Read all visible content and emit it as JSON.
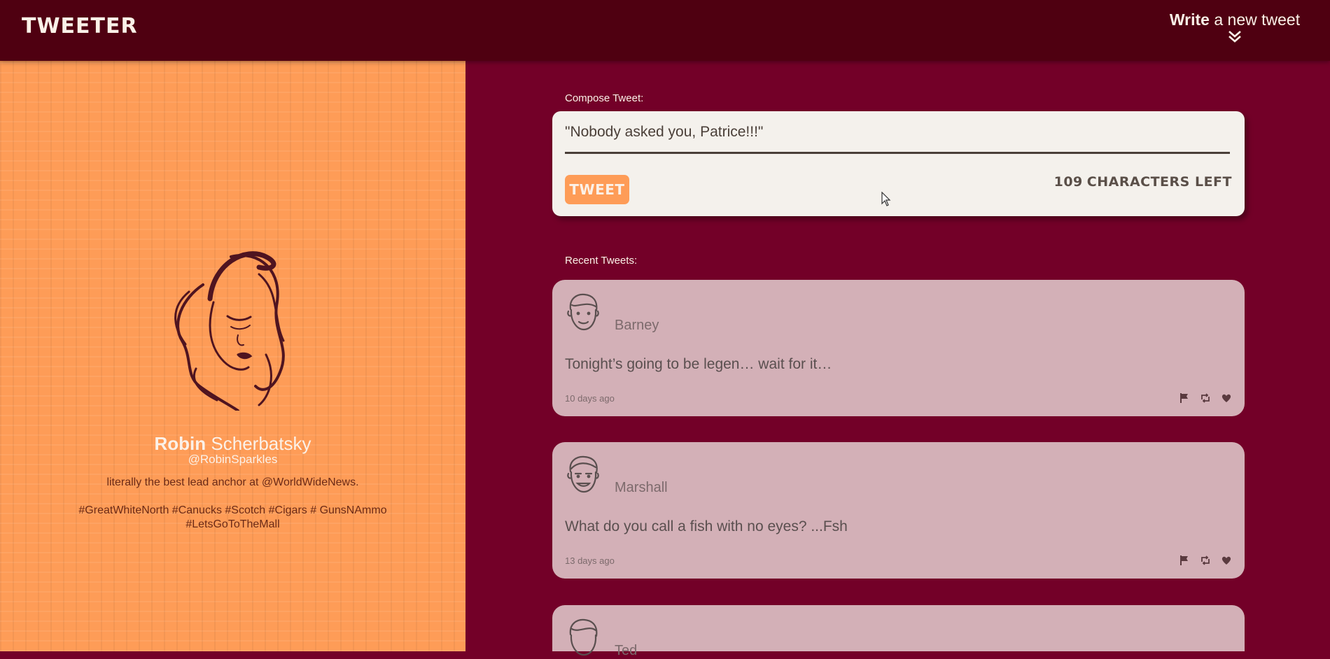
{
  "app": {
    "logo": "TWEETER"
  },
  "header": {
    "write_bold": "Write",
    "write_rest": " a new tweet",
    "chevron_icon": "double-chevron-down-icon"
  },
  "profile": {
    "first_name": "Robin",
    "last_name": "Scherbatsky",
    "handle": "@RobinSparkles",
    "bio": "literally the best lead anchor at @WorldWideNews.",
    "tags": "#GreatWhiteNorth #Canucks #Scotch #Cigars # GunsNAmmo #LetsGoToTheMall",
    "avatar_icon": "woman-portrait-icon"
  },
  "compose": {
    "label": "Compose Tweet:",
    "text": "\"Nobody asked you, Patrice!!!\"",
    "button": "TWEET",
    "chars_left": "109",
    "chars_left_suffix": "CHARACTERS LEFT"
  },
  "recent": {
    "label": "Recent Tweets:",
    "tweets": [
      {
        "name": "Barney",
        "text": "Tonight’s going to be legen… wait for it…",
        "time": "10 days ago"
      },
      {
        "name": "Marshall",
        "text": "What do you call a fish with no eyes? ...Fsh",
        "time": "13 days ago"
      },
      {
        "name": "Ted",
        "text": "",
        "time": ""
      }
    ],
    "action_icons": [
      "flag-icon",
      "retweet-icon",
      "heart-icon"
    ]
  },
  "colors": {
    "header": "#4f0011",
    "main": "#730028",
    "sidebar": "#fe9c57",
    "card": "#d3b0b7",
    "compose": "#f4f1ec",
    "text_light": "#fbf1e8"
  }
}
